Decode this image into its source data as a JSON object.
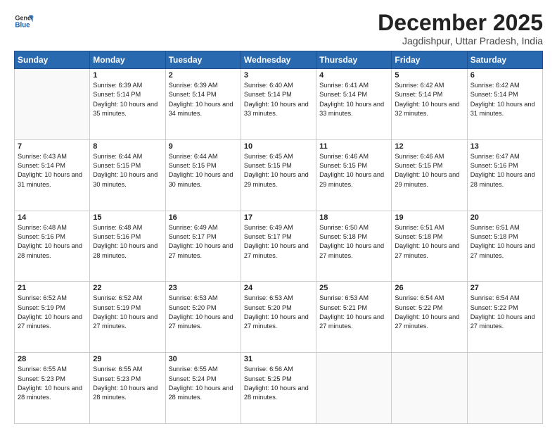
{
  "header": {
    "logo_line1": "General",
    "logo_line2": "Blue",
    "month": "December 2025",
    "location": "Jagdishpur, Uttar Pradesh, India"
  },
  "weekdays": [
    "Sunday",
    "Monday",
    "Tuesday",
    "Wednesday",
    "Thursday",
    "Friday",
    "Saturday"
  ],
  "weeks": [
    [
      {
        "day": "",
        "sunrise": "",
        "sunset": "",
        "daylight": ""
      },
      {
        "day": "1",
        "sunrise": "Sunrise: 6:39 AM",
        "sunset": "Sunset: 5:14 PM",
        "daylight": "Daylight: 10 hours and 35 minutes."
      },
      {
        "day": "2",
        "sunrise": "Sunrise: 6:39 AM",
        "sunset": "Sunset: 5:14 PM",
        "daylight": "Daylight: 10 hours and 34 minutes."
      },
      {
        "day": "3",
        "sunrise": "Sunrise: 6:40 AM",
        "sunset": "Sunset: 5:14 PM",
        "daylight": "Daylight: 10 hours and 33 minutes."
      },
      {
        "day": "4",
        "sunrise": "Sunrise: 6:41 AM",
        "sunset": "Sunset: 5:14 PM",
        "daylight": "Daylight: 10 hours and 33 minutes."
      },
      {
        "day": "5",
        "sunrise": "Sunrise: 6:42 AM",
        "sunset": "Sunset: 5:14 PM",
        "daylight": "Daylight: 10 hours and 32 minutes."
      },
      {
        "day": "6",
        "sunrise": "Sunrise: 6:42 AM",
        "sunset": "Sunset: 5:14 PM",
        "daylight": "Daylight: 10 hours and 31 minutes."
      }
    ],
    [
      {
        "day": "7",
        "sunrise": "Sunrise: 6:43 AM",
        "sunset": "Sunset: 5:14 PM",
        "daylight": "Daylight: 10 hours and 31 minutes."
      },
      {
        "day": "8",
        "sunrise": "Sunrise: 6:44 AM",
        "sunset": "Sunset: 5:15 PM",
        "daylight": "Daylight: 10 hours and 30 minutes."
      },
      {
        "day": "9",
        "sunrise": "Sunrise: 6:44 AM",
        "sunset": "Sunset: 5:15 PM",
        "daylight": "Daylight: 10 hours and 30 minutes."
      },
      {
        "day": "10",
        "sunrise": "Sunrise: 6:45 AM",
        "sunset": "Sunset: 5:15 PM",
        "daylight": "Daylight: 10 hours and 29 minutes."
      },
      {
        "day": "11",
        "sunrise": "Sunrise: 6:46 AM",
        "sunset": "Sunset: 5:15 PM",
        "daylight": "Daylight: 10 hours and 29 minutes."
      },
      {
        "day": "12",
        "sunrise": "Sunrise: 6:46 AM",
        "sunset": "Sunset: 5:15 PM",
        "daylight": "Daylight: 10 hours and 29 minutes."
      },
      {
        "day": "13",
        "sunrise": "Sunrise: 6:47 AM",
        "sunset": "Sunset: 5:16 PM",
        "daylight": "Daylight: 10 hours and 28 minutes."
      }
    ],
    [
      {
        "day": "14",
        "sunrise": "Sunrise: 6:48 AM",
        "sunset": "Sunset: 5:16 PM",
        "daylight": "Daylight: 10 hours and 28 minutes."
      },
      {
        "day": "15",
        "sunrise": "Sunrise: 6:48 AM",
        "sunset": "Sunset: 5:16 PM",
        "daylight": "Daylight: 10 hours and 28 minutes."
      },
      {
        "day": "16",
        "sunrise": "Sunrise: 6:49 AM",
        "sunset": "Sunset: 5:17 PM",
        "daylight": "Daylight: 10 hours and 27 minutes."
      },
      {
        "day": "17",
        "sunrise": "Sunrise: 6:49 AM",
        "sunset": "Sunset: 5:17 PM",
        "daylight": "Daylight: 10 hours and 27 minutes."
      },
      {
        "day": "18",
        "sunrise": "Sunrise: 6:50 AM",
        "sunset": "Sunset: 5:18 PM",
        "daylight": "Daylight: 10 hours and 27 minutes."
      },
      {
        "day": "19",
        "sunrise": "Sunrise: 6:51 AM",
        "sunset": "Sunset: 5:18 PM",
        "daylight": "Daylight: 10 hours and 27 minutes."
      },
      {
        "day": "20",
        "sunrise": "Sunrise: 6:51 AM",
        "sunset": "Sunset: 5:18 PM",
        "daylight": "Daylight: 10 hours and 27 minutes."
      }
    ],
    [
      {
        "day": "21",
        "sunrise": "Sunrise: 6:52 AM",
        "sunset": "Sunset: 5:19 PM",
        "daylight": "Daylight: 10 hours and 27 minutes."
      },
      {
        "day": "22",
        "sunrise": "Sunrise: 6:52 AM",
        "sunset": "Sunset: 5:19 PM",
        "daylight": "Daylight: 10 hours and 27 minutes."
      },
      {
        "day": "23",
        "sunrise": "Sunrise: 6:53 AM",
        "sunset": "Sunset: 5:20 PM",
        "daylight": "Daylight: 10 hours and 27 minutes."
      },
      {
        "day": "24",
        "sunrise": "Sunrise: 6:53 AM",
        "sunset": "Sunset: 5:20 PM",
        "daylight": "Daylight: 10 hours and 27 minutes."
      },
      {
        "day": "25",
        "sunrise": "Sunrise: 6:53 AM",
        "sunset": "Sunset: 5:21 PM",
        "daylight": "Daylight: 10 hours and 27 minutes."
      },
      {
        "day": "26",
        "sunrise": "Sunrise: 6:54 AM",
        "sunset": "Sunset: 5:22 PM",
        "daylight": "Daylight: 10 hours and 27 minutes."
      },
      {
        "day": "27",
        "sunrise": "Sunrise: 6:54 AM",
        "sunset": "Sunset: 5:22 PM",
        "daylight": "Daylight: 10 hours and 27 minutes."
      }
    ],
    [
      {
        "day": "28",
        "sunrise": "Sunrise: 6:55 AM",
        "sunset": "Sunset: 5:23 PM",
        "daylight": "Daylight: 10 hours and 28 minutes."
      },
      {
        "day": "29",
        "sunrise": "Sunrise: 6:55 AM",
        "sunset": "Sunset: 5:23 PM",
        "daylight": "Daylight: 10 hours and 28 minutes."
      },
      {
        "day": "30",
        "sunrise": "Sunrise: 6:55 AM",
        "sunset": "Sunset: 5:24 PM",
        "daylight": "Daylight: 10 hours and 28 minutes."
      },
      {
        "day": "31",
        "sunrise": "Sunrise: 6:56 AM",
        "sunset": "Sunset: 5:25 PM",
        "daylight": "Daylight: 10 hours and 28 minutes."
      },
      {
        "day": "",
        "sunrise": "",
        "sunset": "",
        "daylight": ""
      },
      {
        "day": "",
        "sunrise": "",
        "sunset": "",
        "daylight": ""
      },
      {
        "day": "",
        "sunrise": "",
        "sunset": "",
        "daylight": ""
      }
    ]
  ]
}
